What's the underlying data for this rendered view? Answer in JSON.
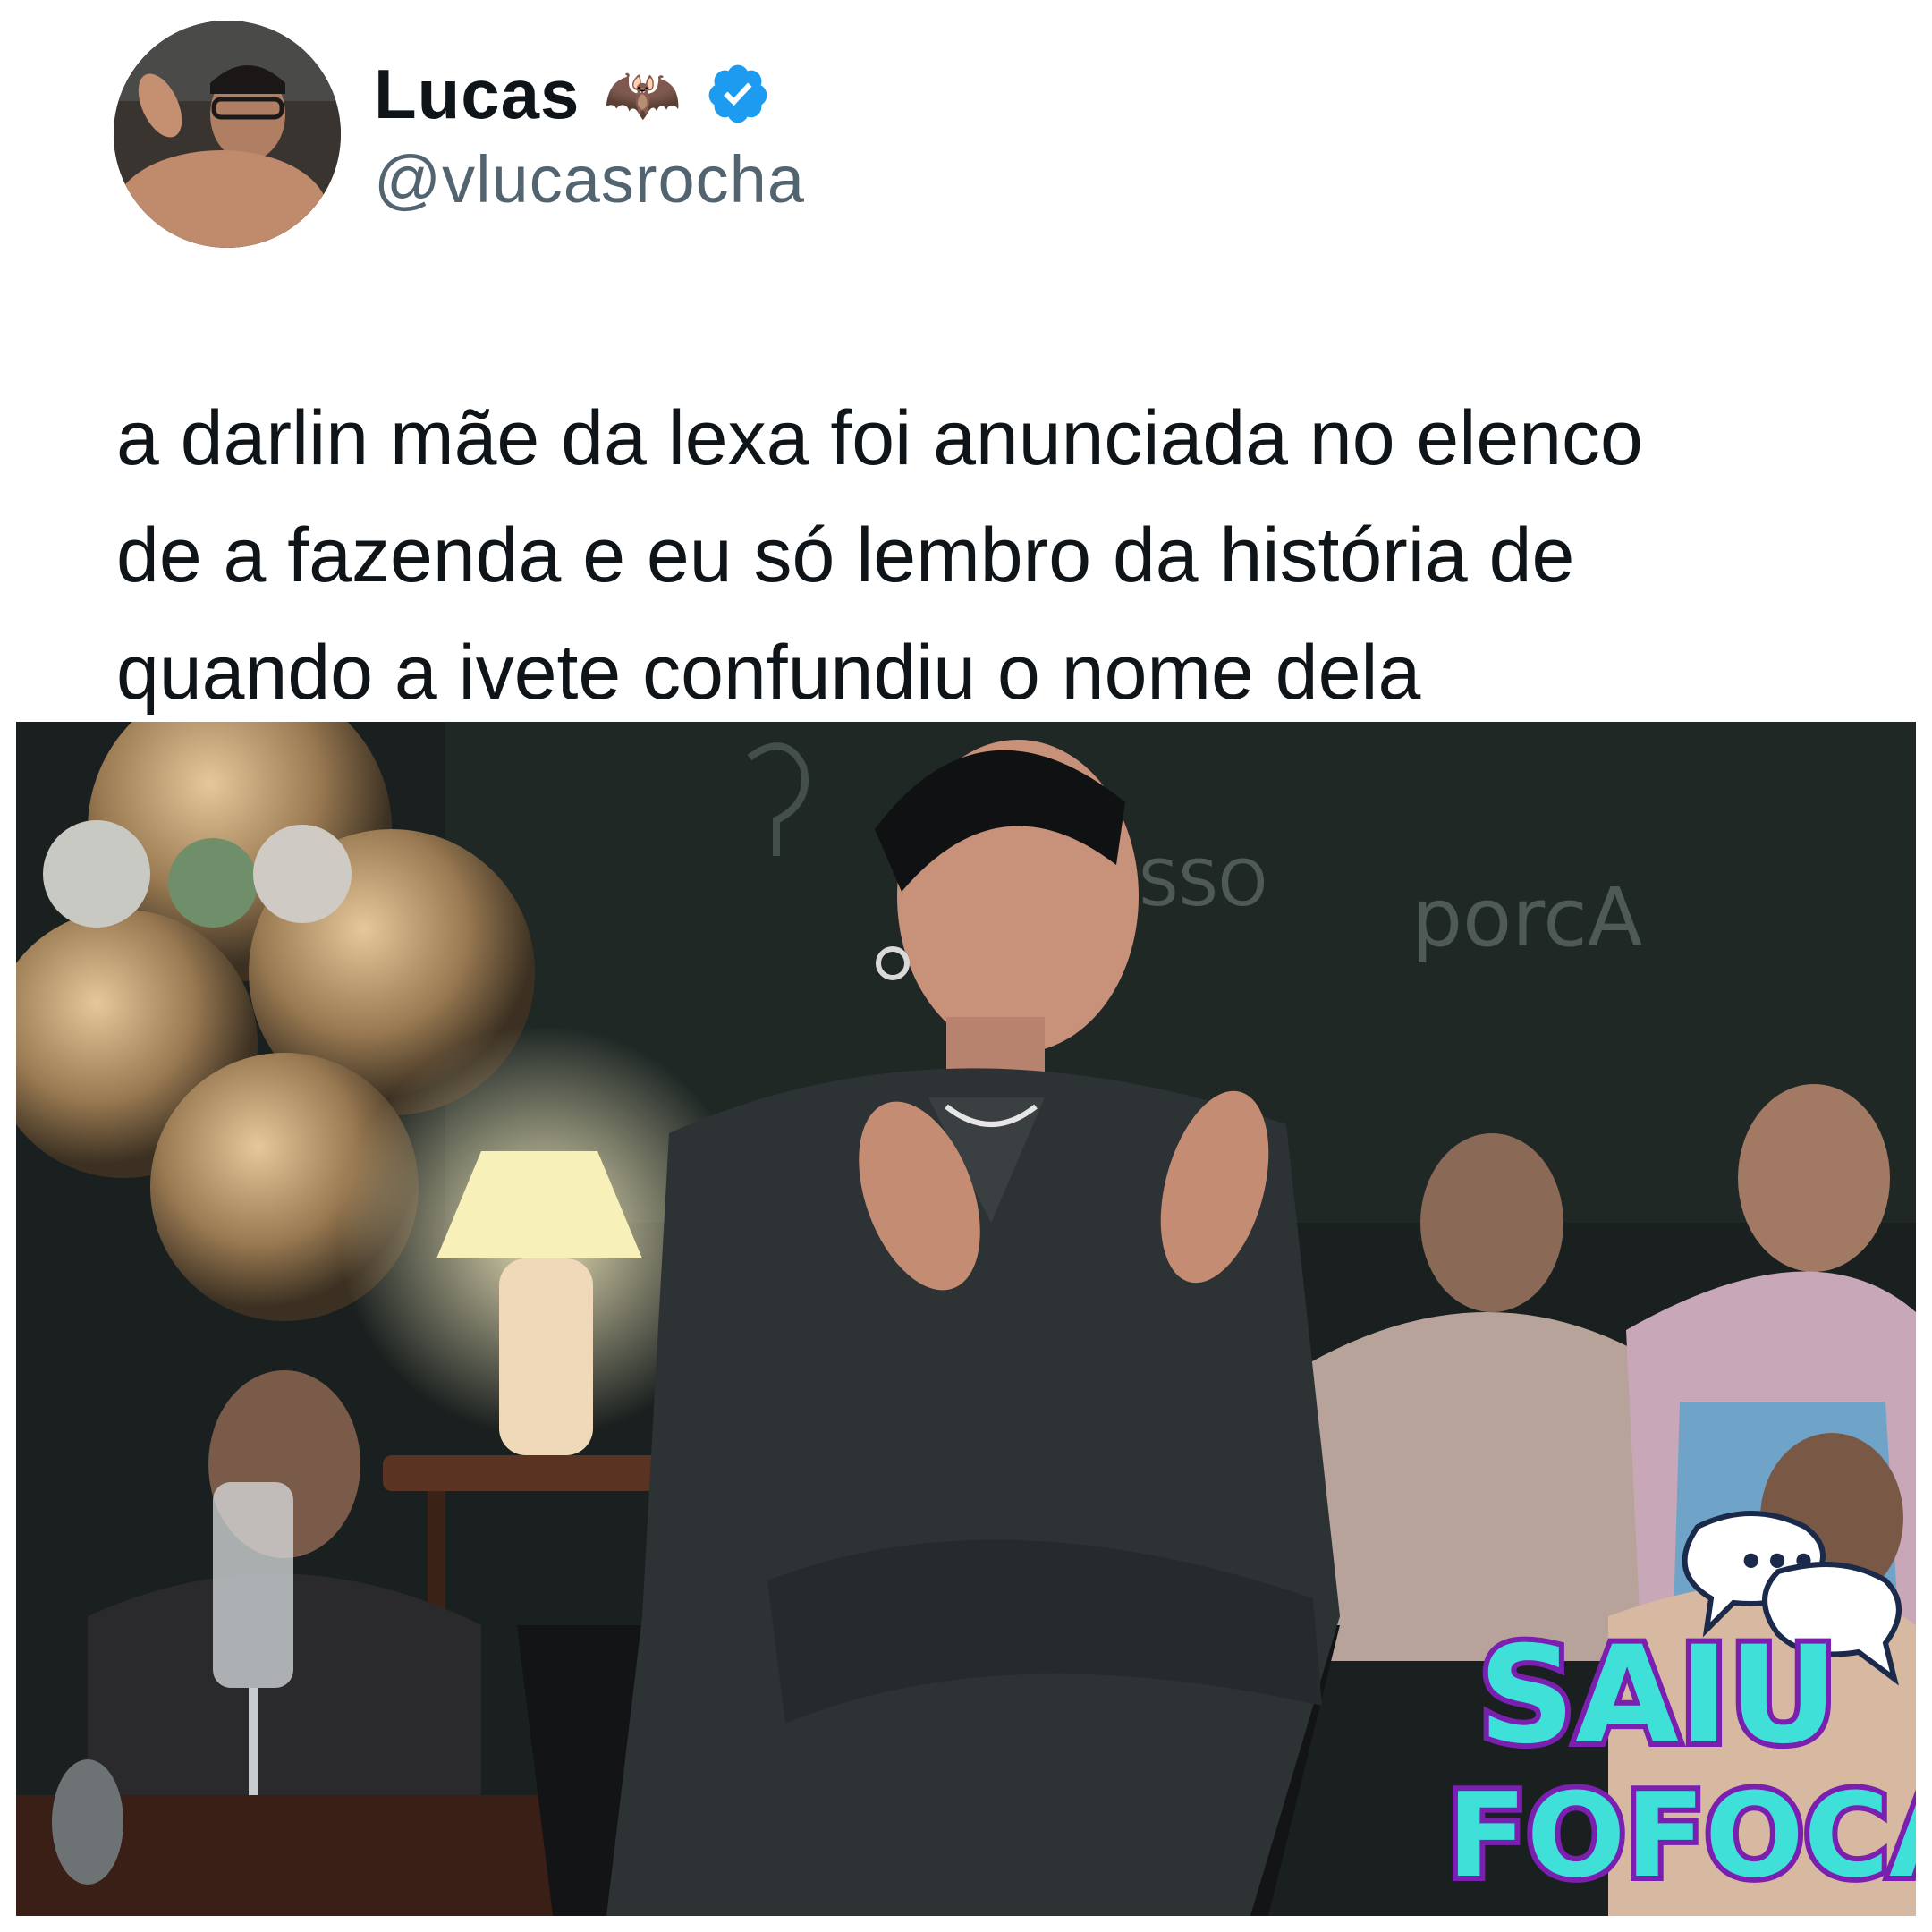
{
  "tweet": {
    "author": {
      "display_name": "Lucas",
      "name_emoji": "🦇",
      "handle": "@vlucasrocha",
      "verified": true
    },
    "text": "a darlin mãe da lexa foi anunciada no elenco de a fazenda e eu só lembro da história de quando a ivete confundiu o nome dela",
    "text_lines": [
      "a darlin mãe da lexa foi anunciada no elenco",
      "de a fazenda e eu só lembro da história de",
      "quando a ivete confundiu o nome dela"
    ],
    "media": {
      "chalkboard_words": [
        "SSO",
        "porcA"
      ],
      "watermark": {
        "line1": "SAIU",
        "line2": "FOFOCA",
        "bubble_text": "•••"
      }
    }
  },
  "colors": {
    "text_primary": "#0f1419",
    "text_secondary": "#536471",
    "verified_blue": "#1d9bf0",
    "watermark_fill": "#3fe0d8",
    "watermark_outline": "#7a1fb0"
  }
}
